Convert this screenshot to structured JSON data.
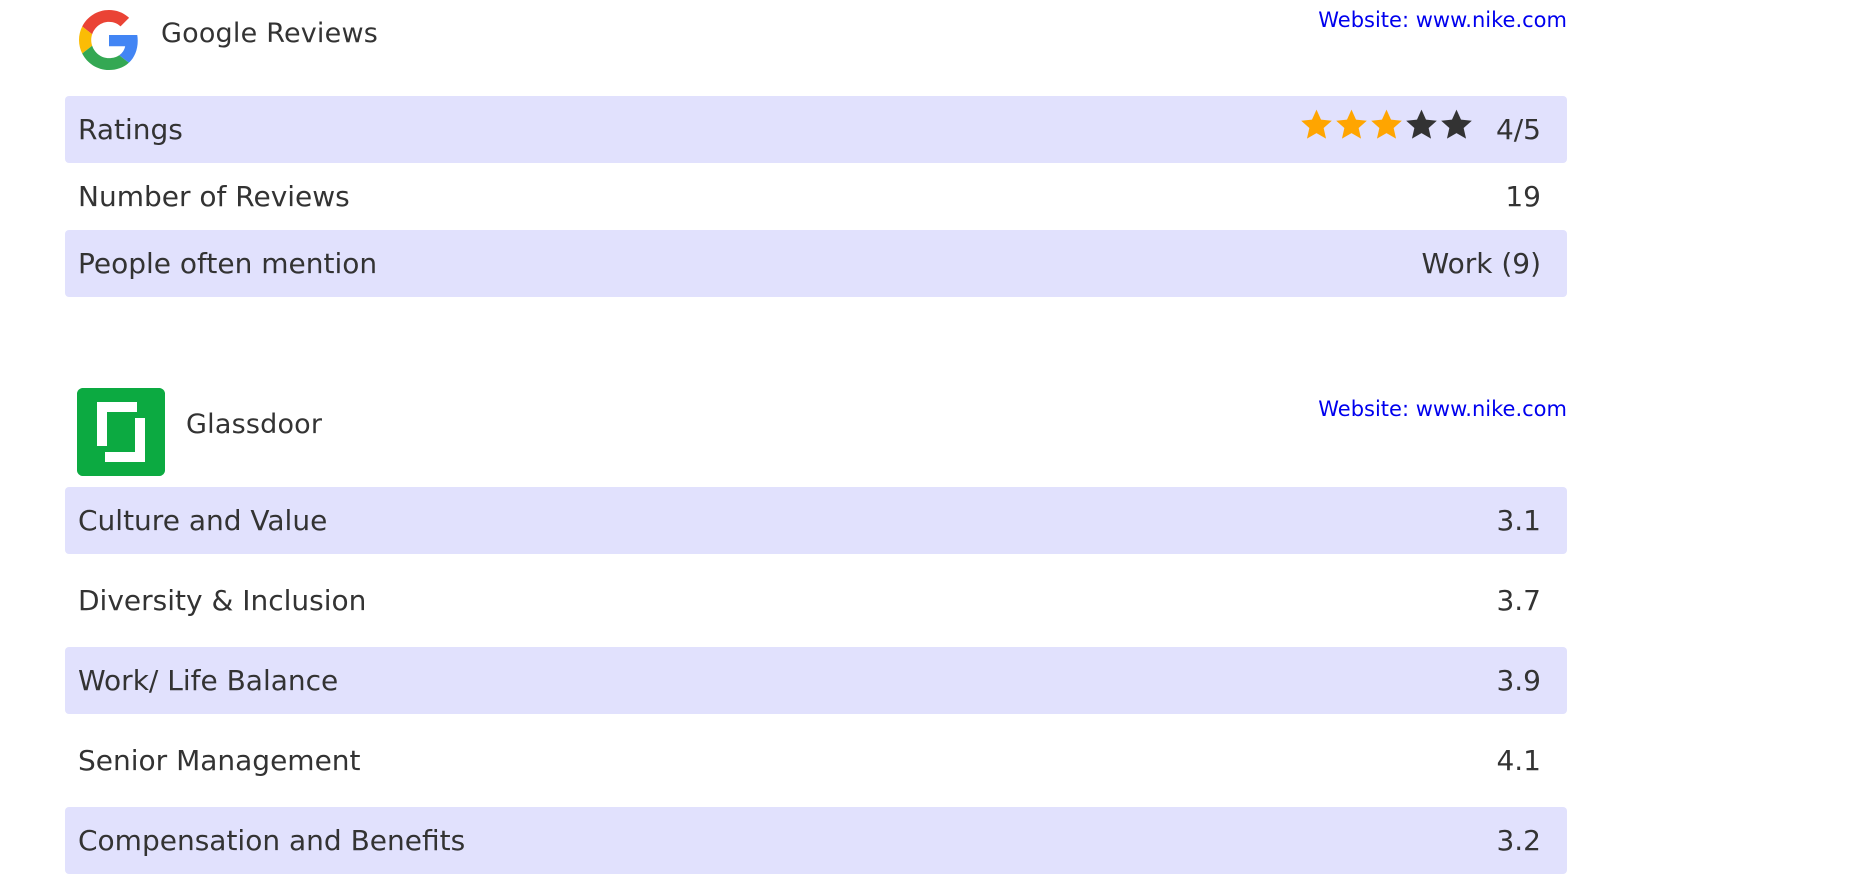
{
  "google": {
    "name": "Google Reviews",
    "website": "Website: www.nike.com",
    "rows": [
      {
        "label": "Ratings",
        "value": "4/5",
        "stars_filled": 3,
        "stars_total": 5
      },
      {
        "label": "Number of Reviews",
        "value": "19"
      },
      {
        "label": "People often mention",
        "value": "Work (9)"
      }
    ],
    "star_color_filled": "#ffa500",
    "star_color_empty": "#333333"
  },
  "glassdoor": {
    "name": "Glassdoor",
    "website": "Website: www.nike.com",
    "brand_color": "#0caa41",
    "rows": [
      {
        "label": "Culture and Value",
        "value": "3.1"
      },
      {
        "label": "Diversity & Inclusion",
        "value": "3.7"
      },
      {
        "label": "Work/ Life Balance",
        "value": "3.9"
      },
      {
        "label": "Senior Management",
        "value": "4.1"
      },
      {
        "label": "Compensation and Benefits",
        "value": "3.2"
      }
    ]
  },
  "colors": {
    "row_shade": "#e1e1fd",
    "link": "#0000ee",
    "text": "#333333"
  }
}
